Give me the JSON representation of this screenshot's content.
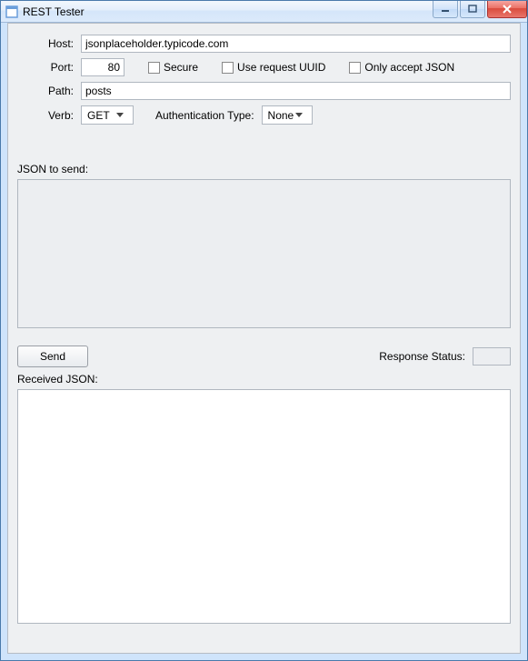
{
  "window": {
    "title": "REST Tester"
  },
  "labels": {
    "host": "Host:",
    "port": "Port:",
    "path": "Path:",
    "verb": "Verb:",
    "auth": "Authentication Type:",
    "jsonToSend": "JSON to send:",
    "send": "Send",
    "responseStatus": "Response Status:",
    "receivedJson": "Received JSON:"
  },
  "fields": {
    "host": "jsonplaceholder.typicode.com",
    "port": "80",
    "path": "posts",
    "verb": "GET",
    "auth": "None",
    "jsonBody": "",
    "responseStatus": "",
    "receivedJson": ""
  },
  "checkboxes": {
    "secure": {
      "label": "Secure",
      "checked": false
    },
    "useUuid": {
      "label": "Use request UUID",
      "checked": false
    },
    "onlyJson": {
      "label": "Only accept JSON",
      "checked": false
    }
  }
}
